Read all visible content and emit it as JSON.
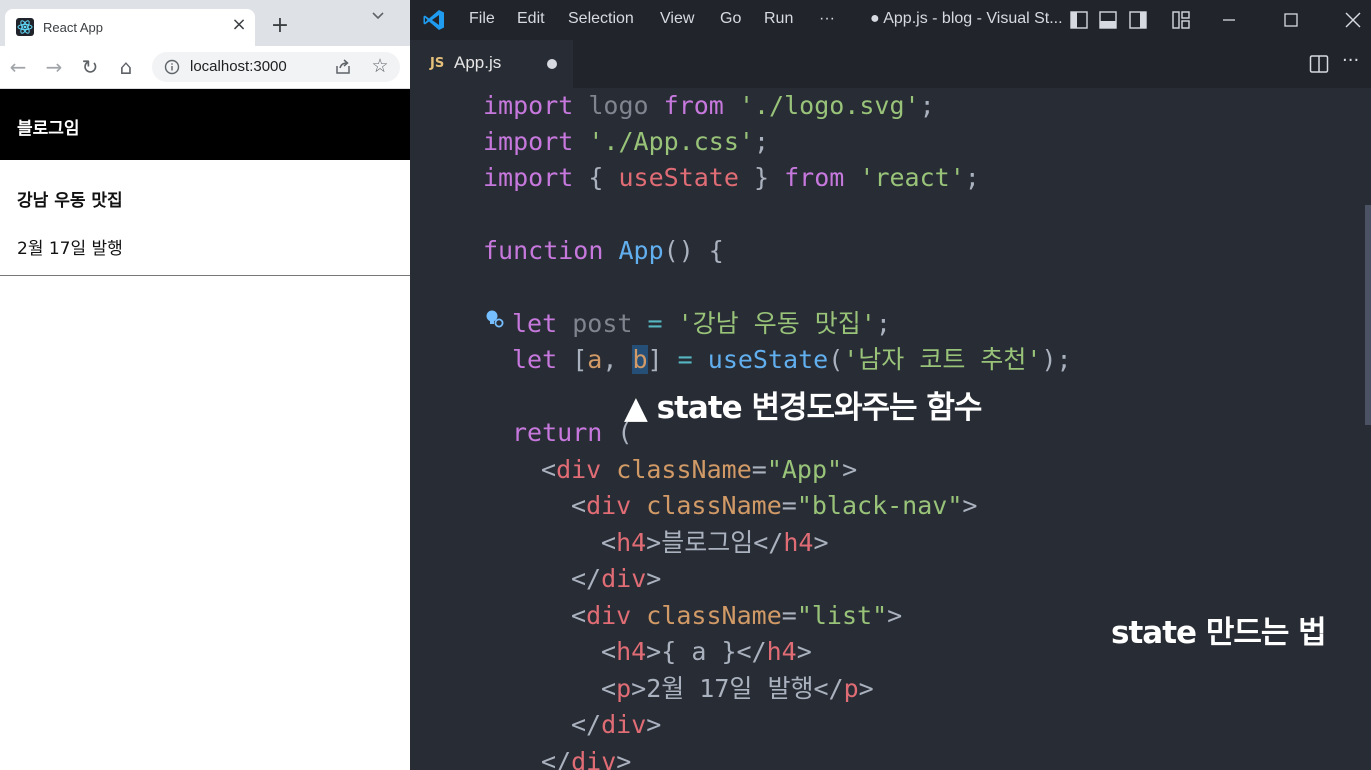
{
  "browser": {
    "tab": {
      "title": "React App",
      "close_glyph": "×",
      "favicon": "react-logo-icon"
    },
    "new_tab_glyph": "+",
    "toolbar": {
      "back_glyph": "←",
      "forward_glyph": "→",
      "reload_glyph": "↻",
      "home_glyph": "⌂",
      "star_glyph": "☆",
      "url": "localhost:3000"
    },
    "page": {
      "nav_title": "블로그임",
      "list_title": "강남 우동 맛집",
      "list_date": "2월 17일 발행"
    }
  },
  "vscode": {
    "menu": [
      "File",
      "Edit",
      "Selection",
      "View",
      "Go",
      "Run",
      "···"
    ],
    "window_title": "● App.js - blog - Visual St...",
    "tab": {
      "badge": "JS",
      "filename": "App.js"
    },
    "more_glyph": "···",
    "code": {
      "l1": {
        "kw1": "import",
        "id": "logo",
        "kw2": "from",
        "str": "'./logo.svg'",
        "end": ";"
      },
      "l2": {
        "kw": "import",
        "str": "'./App.css'",
        "end": ";"
      },
      "l3": {
        "kw1": "import",
        "open": "{",
        "id": "useState",
        "close": "}",
        "kw2": "from",
        "str": "'react'",
        "end": ";"
      },
      "l5": {
        "kw": "function",
        "fn": "App",
        "rest": "() {"
      },
      "l7": {
        "kw": "let",
        "id": "post",
        "op": "=",
        "str": "'강남 우동 맛집'",
        "end": ";"
      },
      "l8": {
        "kw": "let",
        "open": "[",
        "a": "a",
        "comma": ", ",
        "b": "b",
        "close": "]",
        "op": "=",
        "fn": "useState",
        "paren_open": "(",
        "str": "'남자 코트 추천'",
        "paren_close": ");"
      },
      "l10": {
        "kw": "return",
        "rest": "("
      },
      "l11": {
        "lt": "<",
        "tag": "div",
        "attr": "className",
        "eq": "=",
        "str": "\"App\"",
        "gt": ">"
      },
      "l12": {
        "lt": "<",
        "tag": "div",
        "attr": "className",
        "eq": "=",
        "str": "\"black-nav\"",
        "gt": ">"
      },
      "l13": {
        "lt": "<",
        "tag": "h4",
        "gt": ">",
        "text": "블로그임",
        "close_lt": "</",
        "close_tag": "h4",
        "close_gt": ">"
      },
      "l14": {
        "lt": "</",
        "tag": "div",
        "gt": ">"
      },
      "l15": {
        "lt": "<",
        "tag": "div",
        "attr": "className",
        "eq": "=",
        "str": "\"list\"",
        "gt": ">"
      },
      "l16": {
        "lt": "<",
        "tag": "h4",
        "gt": ">",
        "text": "{ a }",
        "close_lt": "</",
        "close_tag": "h4",
        "close_gt": ">"
      },
      "l17": {
        "lt": "<",
        "tag": "p",
        "gt": ">",
        "text": "2월 17일 발행",
        "close_lt": "</",
        "close_tag": "p",
        "close_gt": ">"
      },
      "l18": {
        "lt": "</",
        "tag": "div",
        "gt": ">"
      },
      "l19": {
        "lt": "</",
        "tag": "div",
        "gt": ">"
      }
    },
    "overlay": {
      "caption1": "▲ state 변경도와주는 함수",
      "caption2": "state 만드는 법"
    }
  },
  "colors": {
    "keyword": "#c678dd",
    "string": "#98c379",
    "function": "#61afef",
    "tag": "#e06c75",
    "attribute": "#d19a66",
    "editor_bg": "#282c34",
    "titlebar_bg": "#21252b"
  }
}
